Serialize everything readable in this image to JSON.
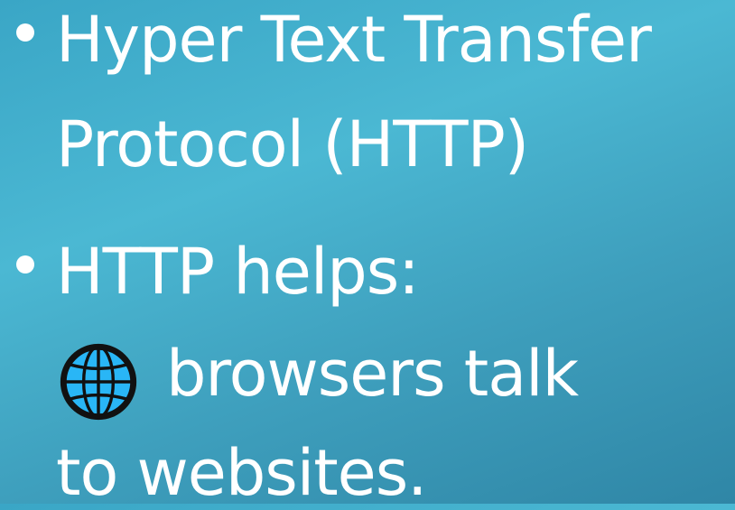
{
  "bullets": [
    {
      "lines": [
        "Hyper Text Transfer",
        "Protocol (HTTP)"
      ]
    },
    {
      "lines": [
        "HTTP helps:",
        "browsers talk",
        "to websites."
      ]
    }
  ],
  "icons": {
    "globe": "globe-icon"
  },
  "colors": {
    "text": "#ffffff",
    "globe_fill": "#29b6f6",
    "globe_outline": "#111111"
  }
}
